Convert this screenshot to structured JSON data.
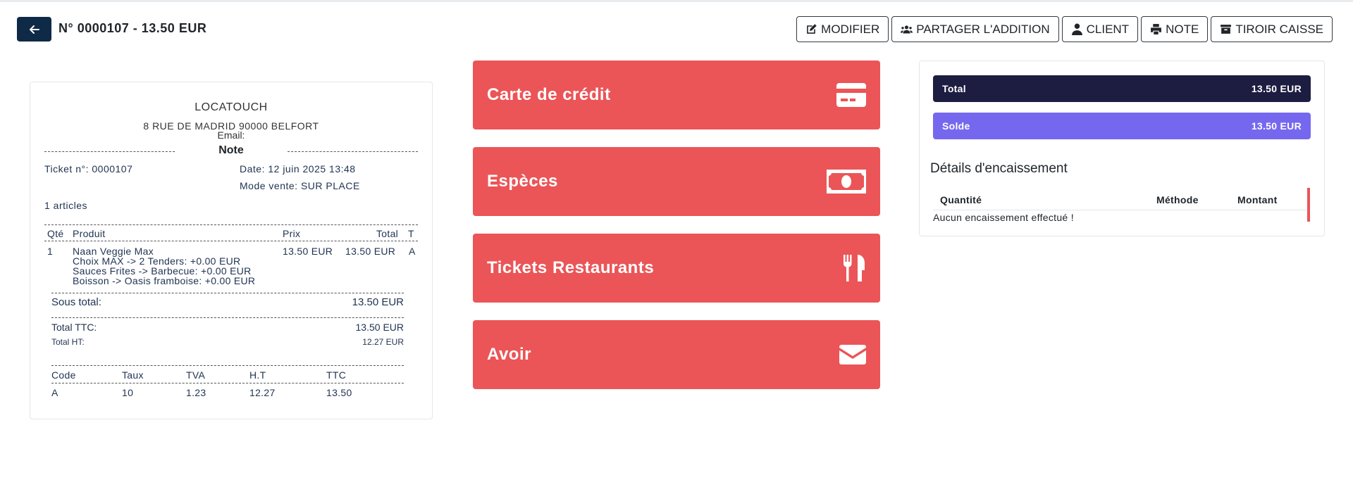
{
  "header": {
    "title": "N° 0000107 - 13.50 EUR",
    "back_icon": "arrow-left-icon",
    "toolbar": [
      {
        "label": "MODIFIER",
        "icon": "edit-icon"
      },
      {
        "label": "PARTAGER L'ADDITION",
        "icon": "users-icon"
      },
      {
        "label": "CLIENT",
        "icon": "user-icon"
      },
      {
        "label": "NOTE",
        "icon": "printer-icon"
      },
      {
        "label": "TIROIR CAISSE",
        "icon": "cash-drawer-icon"
      }
    ]
  },
  "receipt": {
    "company": "LOCATOUCH",
    "address": "8 RUE DE MADRID 90000 BELFORT",
    "email": "Email:",
    "note_label": "Note",
    "ticket": "Ticket n°: 0000107",
    "date": "Date: 12 juin 2025 13:48",
    "mode": "Mode vente: SUR PLACE",
    "articles": "1 articles",
    "columns": {
      "qty": "Qté",
      "product": "Produit",
      "price": "Prix",
      "total": "Total",
      "tax": "T"
    },
    "items": [
      {
        "qty": "1",
        "product": "Naan Veggie Max",
        "price": "13.50 EUR",
        "total": "13.50 EUR",
        "tax": "A",
        "options": [
          "Choix MAX -> 2 Tenders: +0.00 EUR",
          "Sauces Frites -> Barbecue: +0.00 EUR",
          "Boisson -> Oasis framboise: +0.00 EUR"
        ]
      }
    ],
    "subtotal_label": "Sous total:",
    "subtotal_value": "13.50 EUR",
    "total_ttc_label": "Total TTC:",
    "total_ttc_value": "13.50 EUR",
    "total_ht_label": "Total HT:",
    "total_ht_value": "12.27 EUR",
    "tva_columns": {
      "code": "Code",
      "rate": "Taux",
      "tva": "TVA",
      "ht": "H.T",
      "ttc": "TTC"
    },
    "tva_rows": [
      {
        "code": "A",
        "rate": "10",
        "tva": "1.23",
        "ht": "12.27",
        "ttc": "13.50"
      }
    ]
  },
  "payment_methods": [
    {
      "label": "Carte de crédit",
      "icon": "credit-card-icon"
    },
    {
      "label": "Espèces",
      "icon": "banknote-icon"
    },
    {
      "label": "Tickets Restaurants",
      "icon": "utensils-icon"
    },
    {
      "label": "Avoir",
      "icon": "envelope-icon"
    }
  ],
  "summary": {
    "total_label": "Total",
    "total_value": "13.50 EUR",
    "solde_label": "Solde",
    "solde_value": "13.50 EUR",
    "details_title": "Détails d'encaissement",
    "columns": {
      "qty": "Quantité",
      "method": "Méthode",
      "amount": "Montant"
    },
    "empty_text": "Aucun encaissement effectué !"
  },
  "colors": {
    "primary_dark": "#0e2a47",
    "payment_red": "#eb5557",
    "total_bar": "#1d1d42",
    "solde_bar": "#7668ee"
  }
}
